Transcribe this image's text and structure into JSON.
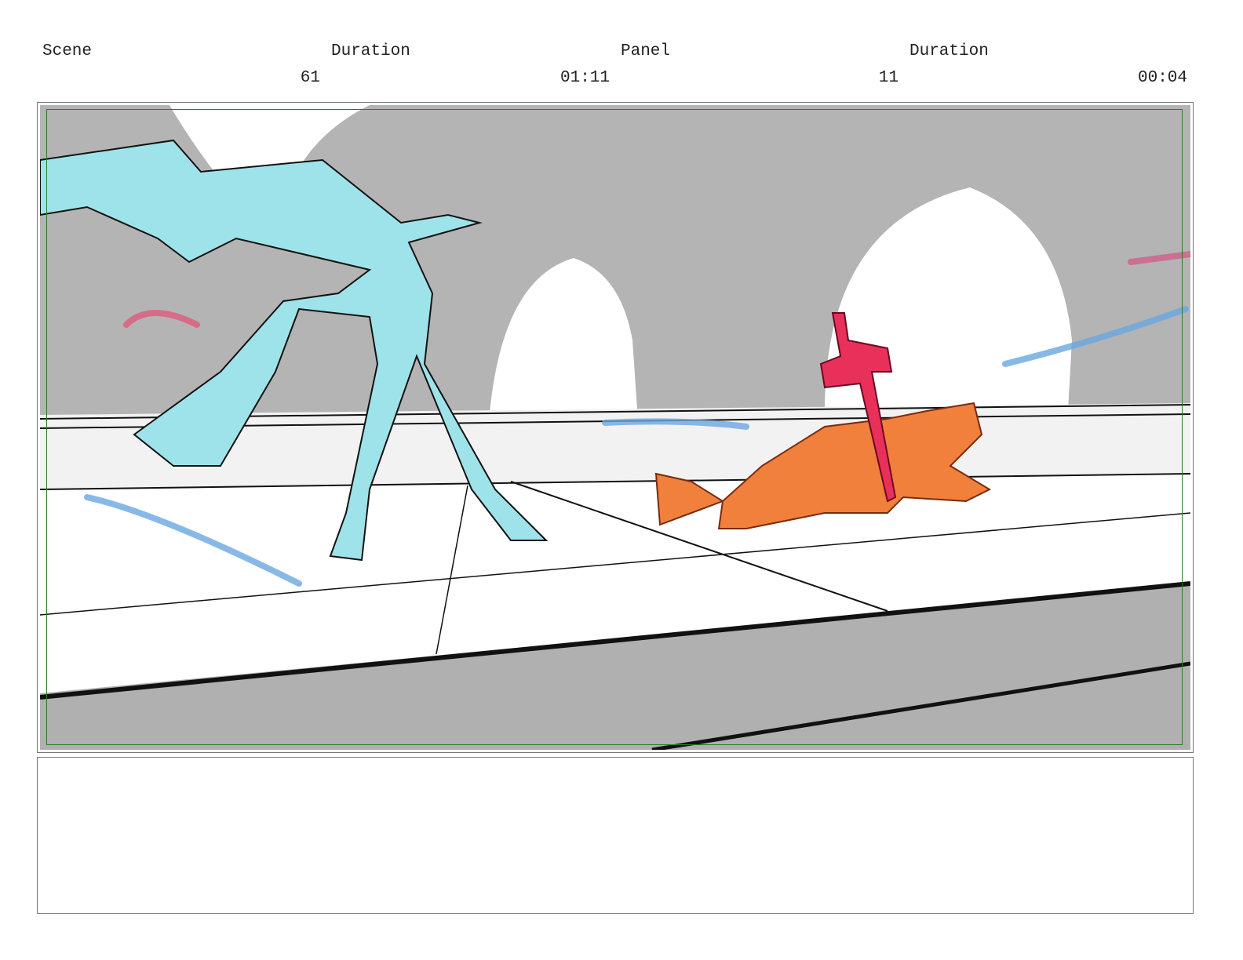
{
  "header": {
    "scene_label": "Scene",
    "scene_duration_label": "Duration",
    "panel_label": "Panel",
    "panel_duration_label": "Duration",
    "scene_value": "61",
    "scene_duration_value": "01:11",
    "panel_value": "11",
    "panel_duration_value": "00:04"
  },
  "panel": {
    "colors": {
      "safe_frame": "#2a7a2a",
      "figure_left": "#9ee3ea",
      "figure_right": "#f0803c",
      "sword": "#e8305a"
    }
  },
  "notes": {
    "text": ""
  }
}
